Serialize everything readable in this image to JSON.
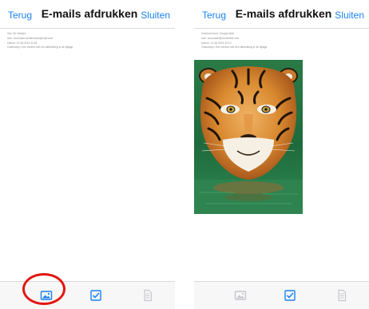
{
  "screens": [
    {
      "nav": {
        "back_label": "Terug",
        "title": "E-mails afdrukken",
        "close_label": "Sluiten"
      },
      "header_lines": [
        "Van: W. Neefjes",
        "Aan: voornaam.achternaam@mail.com",
        "Datum: 12-08-2015 11:56",
        "Onderwerp: Een bericht met een afbeelding in de bijlage"
      ],
      "toolbar": {
        "images_icon": "image-icon",
        "check_icon": "checkbox-icon",
        "doc_icon": "document-icon",
        "images_state": "selected"
      }
    },
    {
      "nav": {
        "back_label": "Terug",
        "title": "E-mails afdrukken",
        "close_label": "Sluiten"
      },
      "header_lines": [
        "Gestuurd door: Google Mail",
        "Aan: voornaam@voorbeeld.com",
        "Datum: 12-08-2015 10:13",
        "Onderwerp: Een bericht met een afbeelding in de bijlage"
      ],
      "attachment_icon": "tiger-photo",
      "toolbar": {
        "images_icon": "image-icon",
        "check_icon": "checkbox-icon",
        "doc_icon": "document-icon",
        "images_state": "disabled"
      }
    }
  ],
  "colors": {
    "accent": "#1a82f0",
    "highlight": "#e3140f",
    "disabled_icon": "#c7c7cc"
  }
}
